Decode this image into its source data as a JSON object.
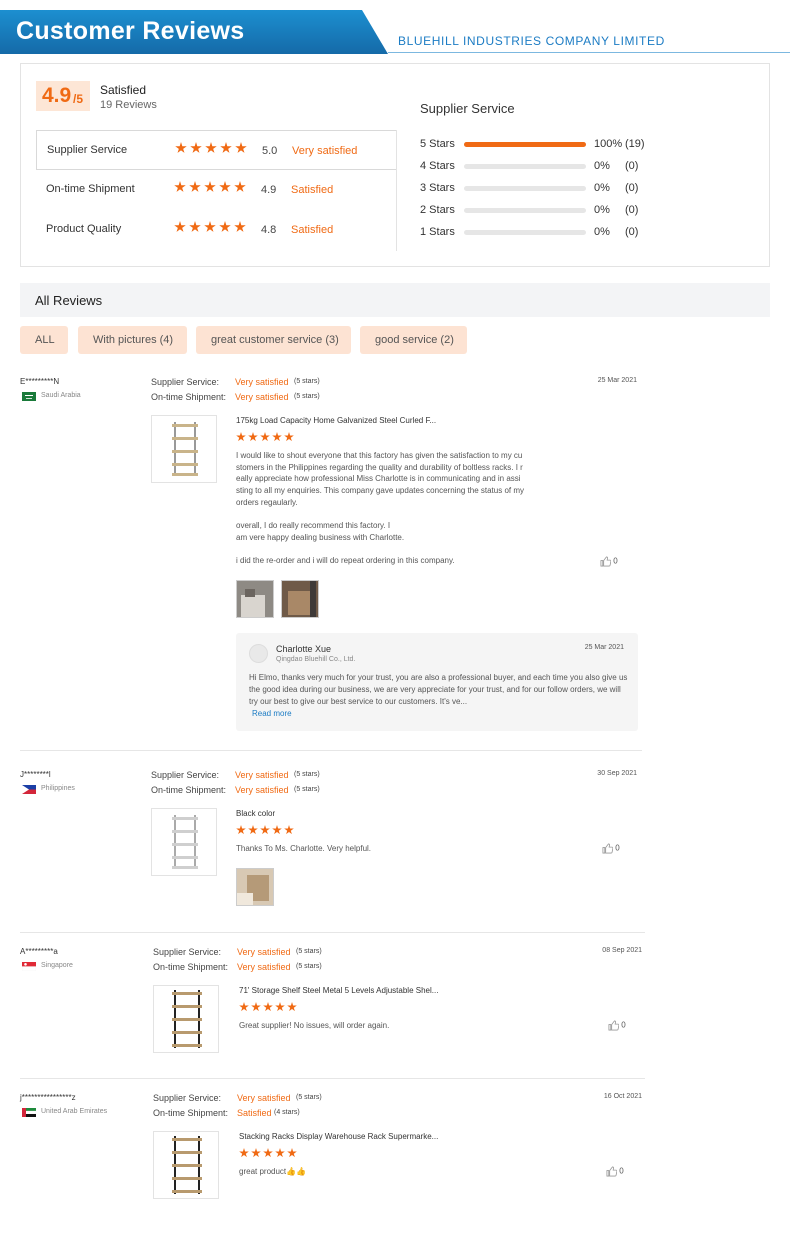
{
  "banner": {
    "title": "Customer Reviews",
    "company": "BLUEHILL INDUSTRIES COMPANY LIMITED"
  },
  "colors": {
    "accent": "#f06a14",
    "banner_blue": "#1c8fd0",
    "tag_bg": "#fde3d3"
  },
  "summary": {
    "score": "4.9",
    "score_den": "/5",
    "label": "Satisfied",
    "count": "19 Reviews",
    "metrics": [
      {
        "name": "Supplier Service",
        "stars": 5,
        "value": "5.0",
        "text": "Very satisfied"
      },
      {
        "name": "On-time Shipment",
        "stars": 5,
        "value": "4.9",
        "text": "Satisfied"
      },
      {
        "name": "Product Quality",
        "stars": 5,
        "value": "4.8",
        "text": "Satisfied"
      }
    ],
    "distribution_title": "Supplier Service",
    "distribution": [
      {
        "label": "5 Stars",
        "fraction": 1.0,
        "pct": "100%",
        "count": "(19)"
      },
      {
        "label": "4 Stars",
        "fraction": 0,
        "pct": "0%",
        "count": "(0)"
      },
      {
        "label": "3 Stars",
        "fraction": 0,
        "pct": "0%",
        "count": "(0)"
      },
      {
        "label": "2 Stars",
        "fraction": 0,
        "pct": "0%",
        "count": "(0)"
      },
      {
        "label": "1 Stars",
        "fraction": 0,
        "pct": "0%",
        "count": "(0)"
      }
    ]
  },
  "all_reviews": {
    "title": "All Reviews",
    "filters": [
      "ALL",
      "With pictures (4)",
      "great customer service (3)",
      "good service (2)"
    ]
  },
  "labels": {
    "supplier_service": "Supplier Service:",
    "on_time": "On-time Shipment:"
  },
  "reviews": [
    {
      "name": "E*********N",
      "country": "Saudi Arabia",
      "flag": "saudi-arabia-flag",
      "date": "25 Mar 2021",
      "service_rating": "Very satisfied",
      "service_stars": "(5 stars)",
      "shipment_rating": "Very satisfied",
      "shipment_stars": "(5 stars)",
      "product": "175kg Load Capacity Home Galvanized Steel Curled F...",
      "stars": 5,
      "text_lines": [
        "I would like to shout everyone that this factory has given the satisfaction to my cu",
        "stomers in the Philippines regarding the quality and durability of boltless racks. I r",
        "eally appreciate how professional Miss Charlotte is in communicating and in assi",
        "sting to all my enquiries. This company gave updates concerning the status of my",
        "orders regaularly.",
        "",
        "overall, I do really recommend this factory. I",
        "am vere happy dealing business with Charlotte.",
        "",
        "i did the re-order and i will do repeat ordering in this company."
      ],
      "likes": "0",
      "reply": {
        "name": "Charlotte Xue",
        "company": "Qingdao Bluehill Co., Ltd.",
        "date": "25 Mar 2021",
        "text": "Hi Elmo, thanks very much for your trust, you are also a professional buyer, and each time you also give us the good idea during our business, we are very appreciate for your trust, and for our follow orders, we will try our best to give our best service to our customers. It's ve...",
        "more": "Read more"
      }
    },
    {
      "name": "J********l",
      "country": "Philippines",
      "flag": "philippines-flag",
      "date": "30 Sep 2021",
      "service_rating": "Very satisfied",
      "service_stars": "(5 stars)",
      "shipment_rating": "Very satisfied",
      "shipment_stars": "(5 stars)",
      "product": "Black color",
      "stars": 5,
      "text": "Thanks To Ms. Charlotte. Very helpful.",
      "likes": "0"
    },
    {
      "name": "A*********a",
      "country": "Singapore",
      "flag": "singapore-flag",
      "date": "08 Sep 2021",
      "service_rating": "Very satisfied",
      "service_stars": "(5 stars)",
      "shipment_rating": "Very satisfied",
      "shipment_stars": "(5 stars)",
      "product": "71' Storage Shelf Steel Metal 5 Levels Adjustable Shel...",
      "stars": 5,
      "text": "Great supplier! No issues, will order again.",
      "likes": "0"
    },
    {
      "name": "j****************z",
      "country": "United Arab Emirates",
      "flag": "uae-flag",
      "date": "16 Oct 2021",
      "service_rating": "Very satisfied",
      "service_stars": "(5 stars)",
      "shipment_rating": "Satisfied",
      "shipment_stars": "(4 stars)",
      "product": "Stacking Racks Display Warehouse Rack Supermarke...",
      "stars": 5,
      "text": "great product👍👍",
      "likes": "0"
    }
  ]
}
